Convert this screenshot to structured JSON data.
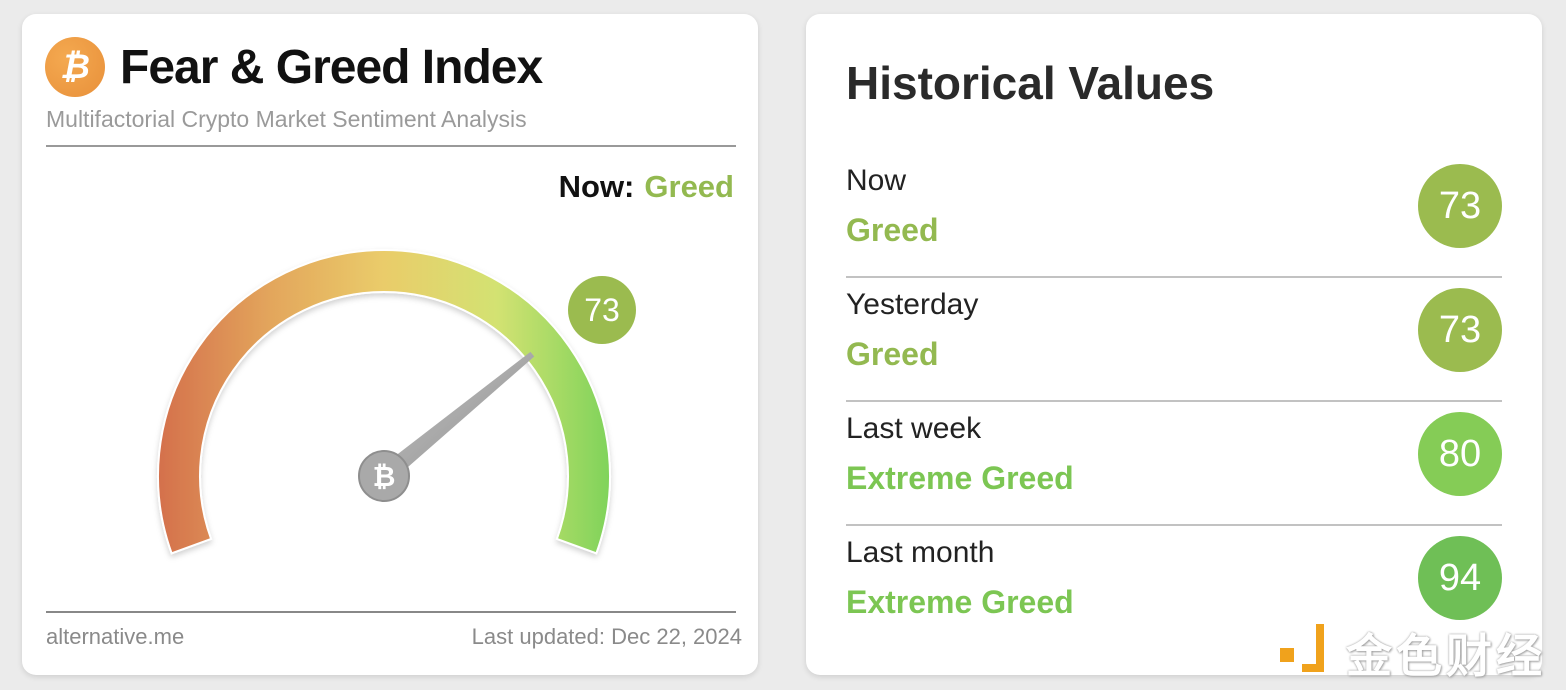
{
  "left_card": {
    "logo_icon": "bitcoin-icon",
    "logo_glyph": "₿",
    "title": "Fear & Greed Index",
    "subtitle": "Multifactorial Crypto Market Sentiment Analysis",
    "now_label": "Now:",
    "now_value": "Greed",
    "gauge": {
      "value": 73,
      "min": 0,
      "max": 100,
      "badge_text": "73",
      "badge_color": "#9bbb4f",
      "hub_icon": "bitcoin-icon",
      "hub_glyph": "₿",
      "gradient_colors": [
        "#d4704c",
        "#e8a85c",
        "#ecd56c",
        "#d6e472",
        "#7fd35a"
      ]
    },
    "footer_source": "alternative.me",
    "footer_updated": "Last updated: Dec 22, 2024"
  },
  "right_card": {
    "title": "Historical Values",
    "rows": [
      {
        "period": "Now",
        "classification": "Greed",
        "value": "73",
        "color": "#9bbb4f",
        "text_color": "#93b950"
      },
      {
        "period": "Yesterday",
        "classification": "Greed",
        "value": "73",
        "color": "#9bbb4f",
        "text_color": "#93b950"
      },
      {
        "period": "Last week",
        "classification": "Extreme Greed",
        "value": "80",
        "color": "#85cc56",
        "text_color": "#7cc653"
      },
      {
        "period": "Last month",
        "classification": "Extreme Greed",
        "value": "94",
        "color": "#6fbf56",
        "text_color": "#7cc653"
      }
    ]
  },
  "watermark": {
    "text": "金色财经"
  }
}
